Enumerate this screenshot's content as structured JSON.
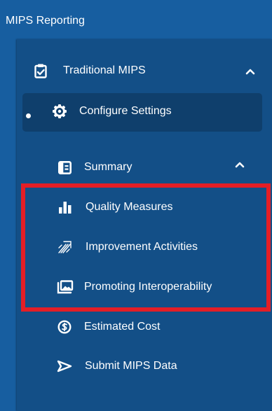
{
  "header": {
    "title": "MIPS Reporting"
  },
  "nav": {
    "group": {
      "label": "Traditional MIPS",
      "icon": "clipboard-check-icon",
      "expanded": true
    },
    "configure": {
      "label": "Configure Settings",
      "icon": "gear-icon",
      "active": true
    },
    "summary": {
      "label": "Summary",
      "icon": "summary-panel-icon",
      "expanded": true
    },
    "quality": {
      "label": "Quality Measures",
      "icon": "bar-chart-icon"
    },
    "improvement": {
      "label": "Improvement Activities",
      "icon": "improvement-arrows-icon"
    },
    "interop": {
      "label": "Promoting Interoperability",
      "icon": "image-stack-icon"
    },
    "cost": {
      "label": "Estimated Cost",
      "icon": "dollar-circle-icon"
    },
    "submit": {
      "label": "Submit MIPS Data",
      "icon": "send-arrow-icon"
    }
  },
  "colors": {
    "background": "#175ea0",
    "panel": "#134f87",
    "active_item": "#0f3f6c",
    "highlight_border": "#e41e26",
    "text": "#ffffff"
  }
}
